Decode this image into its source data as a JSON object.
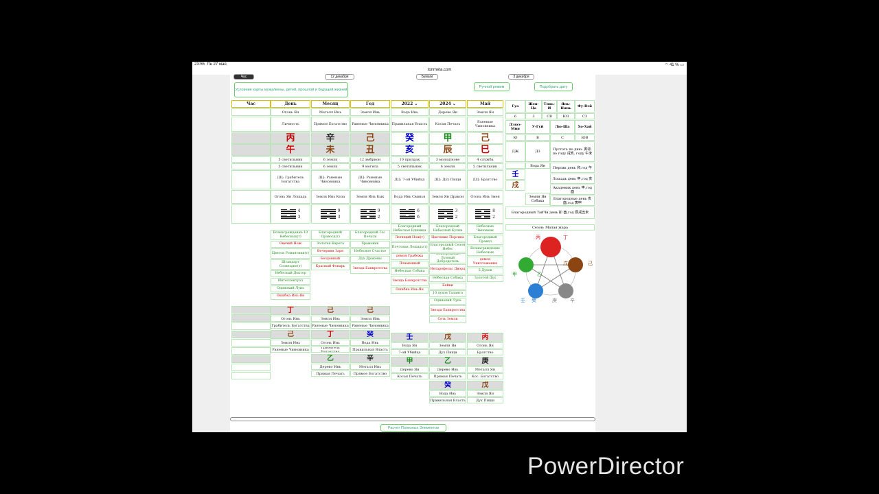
{
  "status": {
    "time": "23:55",
    "date": "Пн 27 мая",
    "battery": "41 %"
  },
  "url": "tonmeta.com",
  "top_buttons": {
    "left": "Час",
    "mid_left": "12 декабря",
    "mid": "Бумаги",
    "right": "3 декабря"
  },
  "conditions_btn": "Условние карты мужа/жены, детей, прошлой и будущей жизней",
  "manual_btn": "Ручной режим",
  "pick_date_btn": "Подобрать дату",
  "columns": [
    "Час",
    "День",
    "Месяц",
    "Год",
    "2022",
    "2024",
    "Май"
  ],
  "elements_row": [
    "",
    "Огонь Ян",
    "Металл Инь",
    "Земля Инь",
    "Вода Инь",
    "Дерево Ян",
    "Земля Ян"
  ],
  "gods_row": [
    "",
    "Личность",
    "Прямое Богатство",
    "Раненые Чиновника",
    "Правильная Власть",
    "Косая Печать",
    "Раненые Чиновника"
  ],
  "stems": [
    "",
    "丙",
    "辛",
    "己",
    "癸",
    "甲",
    "己"
  ],
  "branches": [
    "",
    "午",
    "未",
    "丑",
    "亥",
    "辰",
    "巳"
  ],
  "stage_row1": [
    "",
    "5 светильник",
    "6 землк",
    "12 эмбрион",
    "10 призрак",
    "3 молод/нове",
    "4 служба"
  ],
  "stage_row2": [
    "",
    "5 светильник",
    "6 землк",
    "9 могила",
    "5 светильник",
    "6 земля",
    "5 светильник"
  ],
  "dz_row": [
    "",
    "ДЦ: Грабитель Богатства",
    "ДЦ: Раненые Чиновника",
    "ДЦ: Раненые Чиновника",
    "ДЦ: 7-ой Убийца",
    "ДЦ: Дух Пищи",
    "ДЦ: Братство"
  ],
  "animal_row": [
    "",
    "Огонь Ян Лошадь",
    "Земля Инь Коза",
    "Земля Инь Бык",
    "Вода Инь Свинья",
    "Земля Ян Дракон",
    "Огонь Инь Змея"
  ],
  "hex_nums": [
    [
      "",
      ""
    ],
    [
      "4",
      "3"
    ],
    [
      "9",
      "3"
    ],
    [
      "9",
      "2"
    ],
    [
      "6",
      "6"
    ],
    [
      "3",
      "2"
    ],
    [
      "8",
      "2"
    ]
  ],
  "stars_day": [
    "Вознаграждение 10 Небесных(т)",
    "Овечий Нож",
    "Цветок Романтики(т)",
    "Штандарт Созвездие(т)",
    "Небесный Доктор",
    "Интеллектуал",
    "Одинокий Лунь",
    "Ошибка Инь-Ян"
  ],
  "stars_month": [
    "Благородный Правосд(т)",
    "Золотая Карета",
    "Вечерняя Заря",
    "Бездонный",
    "Красный Фонарь"
  ],
  "stars_year": [
    "Благородный Гос Печати",
    "Храмовик",
    "Небесное Счастье",
    "Дух Драконы",
    "Звезда Банкротства"
  ],
  "stars_2022": [
    "Благородный Небесная Единица",
    "Летящий Нож(т)",
    "Почтовая Лошадь(т)",
    "демон Грабежа",
    "Пламенный",
    "Небесная Собака",
    "Звезда Банкротства",
    "Ошибка Инь-Ян"
  ],
  "stars_2024": [
    "Благородный Небесный Кухни",
    "Цветение Персика",
    "Благородный Сезон Небес",
    "Благородный Лунный Добродетель",
    "Нетарофельс Дворц",
    "Небесная Собака",
    "Бейки",
    "10 духов Таланта",
    "Одинокий Лунь",
    "Звезда Банкротства",
    "Сеть Земли"
  ],
  "stars_may": [
    "Небесные Чиновник",
    "Благородный Правдл",
    "Вознаграждение Небесных",
    "демон Уничтожения",
    "5 Духов",
    "Золотой Дух"
  ],
  "hidden": {
    "day": [
      {
        "stem": "丁",
        "el": "Огонь Инь",
        "god": "Грабитель Богатства"
      },
      {
        "stem": "己",
        "el": "Земля Инь",
        "god": "Раненые Чиновника"
      }
    ],
    "month": [
      {
        "stem": "己",
        "el": "Земля Инь",
        "god": "Раненые Чиновника"
      },
      {
        "stem": "丁",
        "el": "Огонь Инь",
        "god": "Грабитель Богатства"
      },
      {
        "stem": "乙",
        "el": "Дерево Инь",
        "god": "Прямая Печать"
      }
    ],
    "year": [
      {
        "stem": "己",
        "el": "Земля Инь",
        "god": "Раненые Чиновника"
      },
      {
        "stem": "癸",
        "el": "Вода Инь",
        "god": "Правильная Власть"
      },
      {
        "stem": "辛",
        "el": "Металл Инь",
        "god": "Прямое Богатство"
      }
    ],
    "y2022": [
      {
        "stem": "壬",
        "el": "Вода Ян",
        "god": "7-ой Убийца"
      },
      {
        "stem": "甲",
        "el": "Дерево Ян",
        "god": "Косая Печать"
      }
    ],
    "y2024": [
      {
        "stem": "戊",
        "el": "Земля Ян",
        "god": "Дух Пищи"
      },
      {
        "stem": "乙",
        "el": "Дерево Инь",
        "god": "Прямая Печать"
      },
      {
        "stem": "癸",
        "el": "Вода Инь",
        "god": "Правильная Власть"
      }
    ],
    "may": [
      {
        "stem": "丙",
        "el": "Огонь Ян",
        "god": "Братство"
      },
      {
        "stem": "庚",
        "el": "Металл Ян",
        "god": "Кос. Богатство"
      },
      {
        "stem": "戊",
        "el": "Земля Ян",
        "god": "Дух Пищи"
      }
    ]
  },
  "right_header": [
    "Гуа",
    "Шен-Ца",
    "Тянь-И",
    "Янь-Нянь",
    "Фу-Вэй"
  ],
  "right_row1": [
    "6",
    "3",
    "СВ",
    "ЮЗ",
    "СЗ"
  ],
  "right_header2": [
    "Дзюэ-Мин",
    "У-Гуй",
    "Лю-Ша",
    "Хо-Хай"
  ],
  "right_row2": [
    "Ю",
    "В",
    "С",
    "ЮВ"
  ],
  "void": {
    "l1": "ДЖ",
    "l2": "ДЗ",
    "text": "Пустота по дню: 寅卯, по году 戌亥, году 午未"
  },
  "rp": {
    "stem": "壬",
    "branch": "戌",
    "top": "Вода Ян",
    "bottom": "Земля Ян Собака"
  },
  "rp_lines": [
    "Персик день 卯,год 午",
    "Лошадь день 申,год 亥",
    "Академик день 申,год 酉",
    "Благородные день 亥 酉,год 寅申"
  ],
  "taiji": "Благородный ТайЧи день 卯 酉,год 辰戌丑未",
  "season": "Сезон: Малая жара",
  "wheel": {
    "labels": [
      "丙",
      "丁",
      "戊",
      "己",
      "庚",
      "辛",
      "壬",
      "癸",
      "甲",
      "乙"
    ],
    "colors": {
      "fire": "#d22",
      "earth": "#8b4513",
      "metal": "#888",
      "water": "#2a7fd4",
      "wood": "#3a3"
    }
  },
  "calc_btn": "Расчет Полезных Элементов",
  "watermark": "PowerDirector"
}
